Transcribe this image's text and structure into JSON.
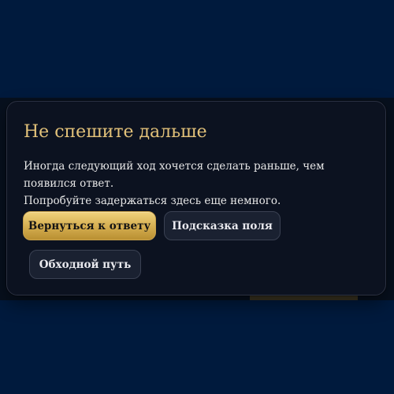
{
  "modal": {
    "title": "Не спешите дальше",
    "body_line_1": "Иногда следующий ход хочется сделать раньше, чем появился ответ.",
    "body_line_2": "Попробуйте задержаться здесь еще немного.",
    "buttons": {
      "return_label": "Вернуться к ответу",
      "hint_label": "Подсказка поля",
      "detour_label": "Обходной путь"
    }
  },
  "colors": {
    "page_background": "#001a3d",
    "modal_background": "#0c1220",
    "title_gold": "#e3c27a",
    "primary_button_gold": "#d4ad4f",
    "secondary_button": "#1a2131"
  }
}
